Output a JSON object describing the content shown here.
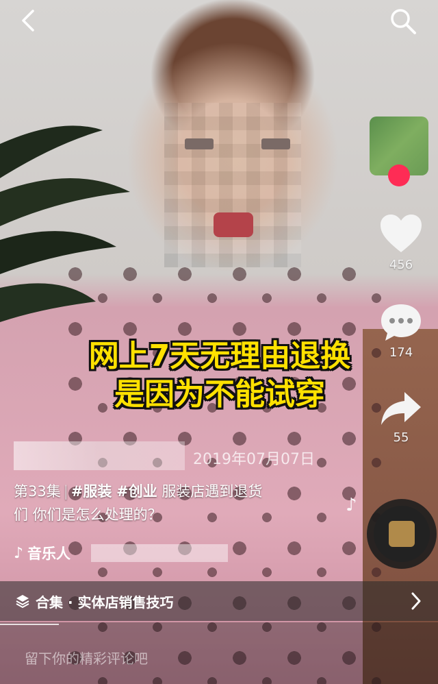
{
  "video": {
    "caption_line1": "网上7天无理由退换",
    "caption_line2": "是因为不能试穿",
    "date": "2019年07月07日"
  },
  "description": {
    "episode": "第33集",
    "tag1": "#服装",
    "tag2": "#创业",
    "text_line1": "服装店遇到退货",
    "text_line2": "们 你们是怎么处理的？"
  },
  "sidebar": {
    "likes": "456",
    "comments": "174",
    "shares": "55"
  },
  "music": {
    "label": "音乐人"
  },
  "collection": {
    "label": "合集 · 实体店销售技巧"
  },
  "comment": {
    "placeholder": "留下你的精彩评论吧"
  },
  "colors": {
    "caption_yellow": "#ffe100",
    "like_red": "#fe2c55"
  }
}
